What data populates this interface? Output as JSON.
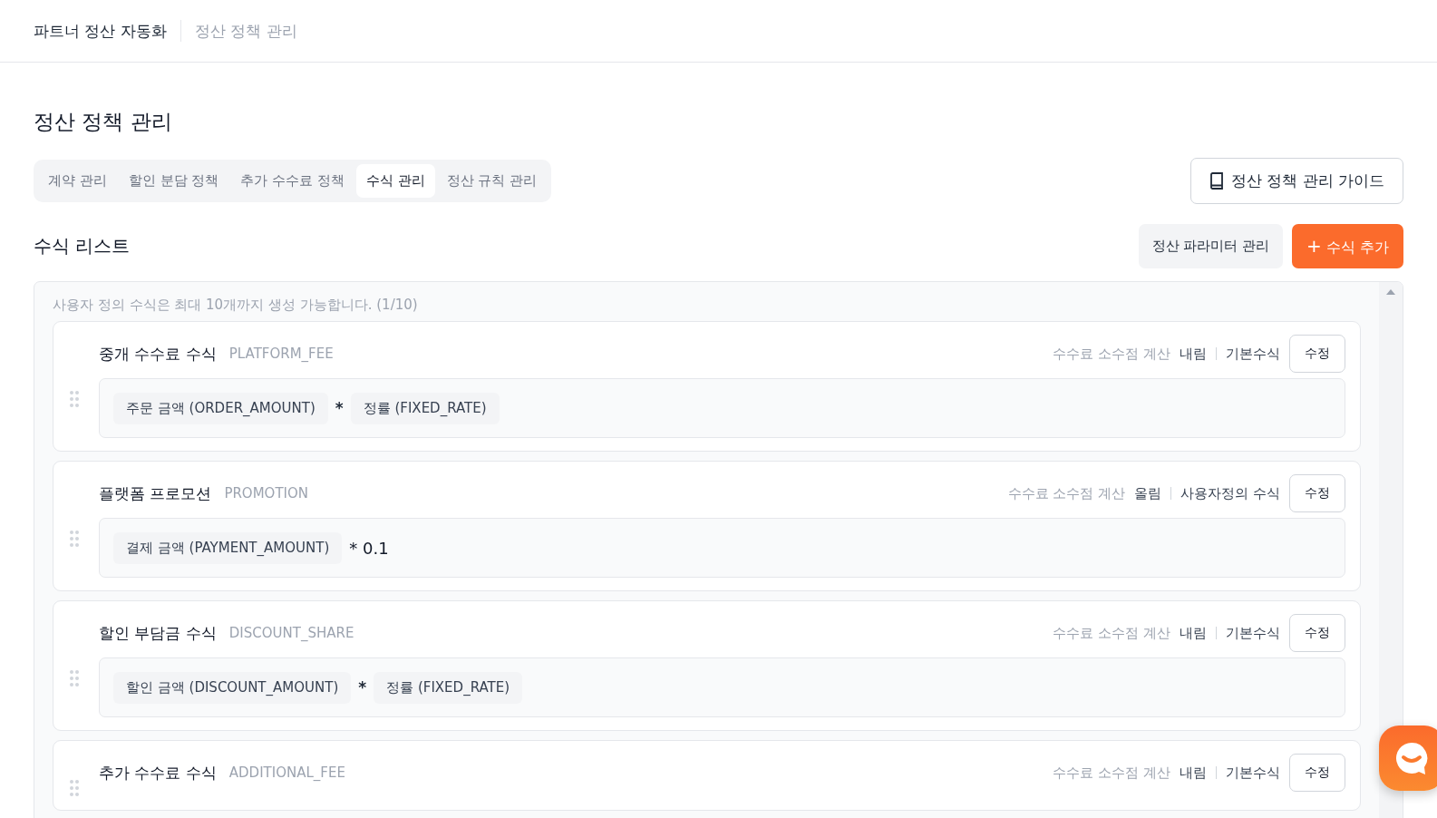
{
  "header": {
    "app_title": "파트너 정산 자동화",
    "breadcrumb": "정산 정책 관리"
  },
  "page_title": "정산 정책 관리",
  "tabs": [
    {
      "label": "계약 관리",
      "selected": false
    },
    {
      "label": "할인 분담 정책",
      "selected": false
    },
    {
      "label": "추가 수수료 정책",
      "selected": false
    },
    {
      "label": "수식 관리",
      "selected": true
    },
    {
      "label": "정산 규칙 관리",
      "selected": false
    }
  ],
  "guide_button": "정산 정책 관리 가이드",
  "section_title": "수식 리스트",
  "parameter_button": "정산 파라미터 관리",
  "add_button": {
    "icon": "+",
    "label": "수식 추가"
  },
  "notice": "사용자 정의 수식은 최대 10개까지 생성 가능합니다. (1/10)",
  "formulas": [
    {
      "name": "중개 수수료 수식",
      "code": "PLATFORM_FEE",
      "rounding_label": "수수료 소수점 계산",
      "rounding": "내림",
      "type": "기본수식",
      "edit": "수정",
      "tokens": [
        {
          "kind": "chip",
          "text": "주문 금액 (ORDER_AMOUNT)"
        },
        {
          "kind": "operator",
          "text": "*"
        },
        {
          "kind": "chip",
          "text": "정률 (FIXED_RATE)"
        }
      ]
    },
    {
      "name": "플랫폼 프로모션",
      "code": "PROMOTION",
      "rounding_label": "수수료 소수점 계산",
      "rounding": "올림",
      "type": "사용자정의 수식",
      "edit": "수정",
      "tokens": [
        {
          "kind": "chip",
          "text": "결제 금액 (PAYMENT_AMOUNT)"
        },
        {
          "kind": "literal",
          "text": "* 0.1"
        }
      ]
    },
    {
      "name": "할인 부담금 수식",
      "code": "DISCOUNT_SHARE",
      "rounding_label": "수수료 소수점 계산",
      "rounding": "내림",
      "type": "기본수식",
      "edit": "수정",
      "tokens": [
        {
          "kind": "chip",
          "text": "할인 금액 (DISCOUNT_AMOUNT)"
        },
        {
          "kind": "operator",
          "text": "*"
        },
        {
          "kind": "chip",
          "text": "정률 (FIXED_RATE)"
        }
      ]
    },
    {
      "name": "추가 수수료 수식",
      "code": "ADDITIONAL_FEE",
      "rounding_label": "수수료 소수점 계산",
      "rounding": "내림",
      "type": "기본수식",
      "edit": "수정"
    }
  ]
}
